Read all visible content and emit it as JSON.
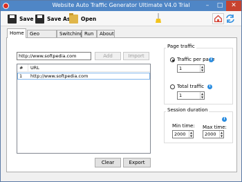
{
  "window": {
    "title": "Website Auto Traffic Generator Ultimate V4.0 Trial"
  },
  "toolbar": {
    "save_label": "Save",
    "saveas_label": "Save As",
    "open_label": "Open"
  },
  "tabs": [
    {
      "label": "Home",
      "active": true
    },
    {
      "label": "Geo location"
    },
    {
      "label": "Switching"
    },
    {
      "label": "Run"
    },
    {
      "label": "About"
    }
  ],
  "home": {
    "url_input": {
      "value": "http://www.softpedia.com"
    },
    "add_label": "Add",
    "import_label": "Import",
    "list": {
      "columns": [
        "#",
        "URL"
      ],
      "rows": [
        {
          "num": "1",
          "url": "http://www.softpedia.com"
        }
      ]
    },
    "clear_label": "Clear",
    "export_label": "Export"
  },
  "page_traffic": {
    "legend": "Page traffic",
    "per_page_label": "Traffic per page",
    "per_page_value": "1",
    "per_page_selected": true,
    "total_label": "Total traffic",
    "total_value": "1"
  },
  "session": {
    "legend": "Session duration",
    "min_label": "Min time:",
    "min_value": "2000",
    "max_label": "Max time:",
    "max_value": "2000"
  },
  "colors": {
    "titlebar": "#4f86c6",
    "info": "#2b8de0",
    "close": "#c7432f"
  }
}
